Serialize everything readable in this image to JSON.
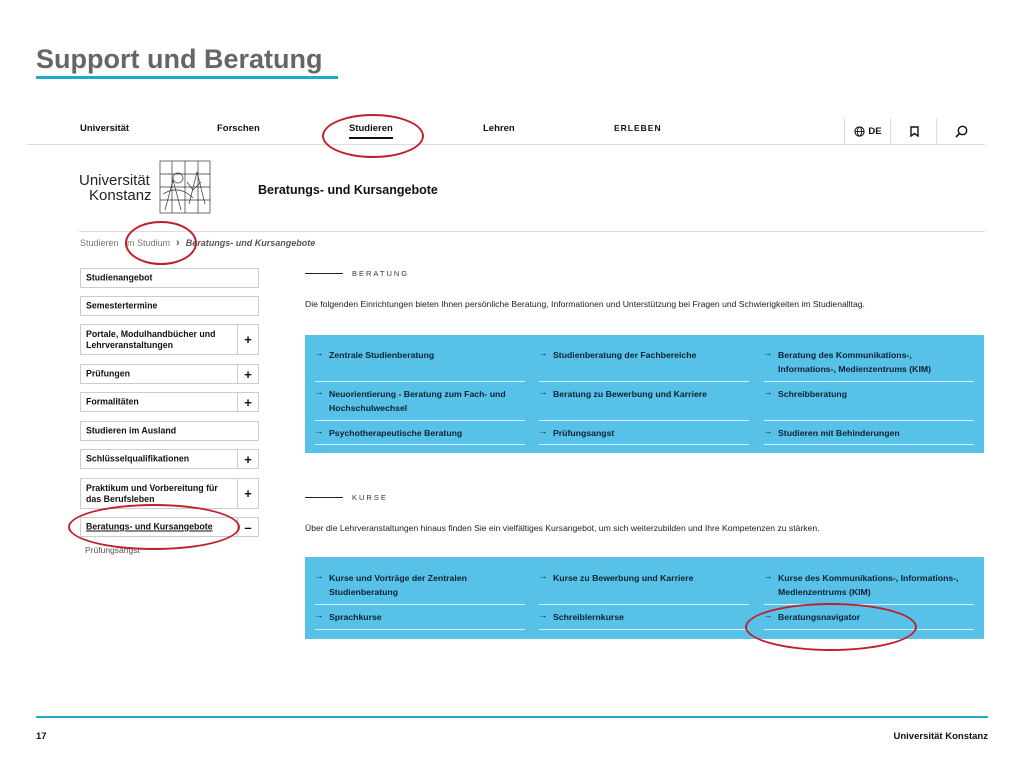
{
  "slide": {
    "title": "Support und Beratung",
    "page_number": "17",
    "footer_text": "Universität Konstanz"
  },
  "website": {
    "nav": {
      "items": [
        "Universität",
        "Forschen",
        "Studieren",
        "Lehren",
        "ERLEBEN"
      ],
      "active": "Studieren",
      "language": "DE",
      "bookmark_icon": "bookmark-icon",
      "search_icon": "search-icon"
    },
    "logo": {
      "line1": "Universität",
      "line2": "Konstanz"
    },
    "page_heading": "Beratungs- und Kursangebote",
    "breadcrumb": [
      "Studieren",
      "Im Studium",
      "Beratungs- und Kursangebote"
    ],
    "sidebar": {
      "items": [
        {
          "label": "Studienangebot",
          "toggle": ""
        },
        {
          "label": "Semestertermine",
          "toggle": ""
        },
        {
          "label": "Portale, Modulhandbücher und Lehrveranstaltungen",
          "toggle": "+"
        },
        {
          "label": "Prüfungen",
          "toggle": "+"
        },
        {
          "label": "Formalitäten",
          "toggle": "+"
        },
        {
          "label": "Studieren im Ausland",
          "toggle": ""
        },
        {
          "label": "Schlüsselqualifikationen",
          "toggle": "+"
        },
        {
          "label": "Praktikum und Vorbereitung für das Berufsleben",
          "toggle": "+"
        },
        {
          "label": "Beratungs- und Kursangebote",
          "toggle": "–"
        }
      ],
      "sub_item": "Prüfungsangst"
    },
    "beratung": {
      "label": "BERATUNG",
      "intro": "Die folgenden Einrichtungen bieten Ihnen persönliche Beratung, Informationen und Unterstützung bei Fragen und Schwierigkeiten im Studienalltag.",
      "links": [
        "Zentrale Studienberatung",
        "Studienberatung der Fachbereiche",
        "Beratung des Kommunikations-, Informations-, Medienzentrums (KIM)",
        "Neuorientierung - Beratung zum Fach- und Hochschulwechsel",
        "Beratung zu Bewerbung und Karriere",
        "Schreibberatung",
        "Psychotherapeutische Beratung",
        "Prüfungsangst",
        "Studieren mit Behinderungen"
      ]
    },
    "kurse": {
      "label": "KURSE",
      "intro": "Über die Lehrveranstaltungen hinaus finden Sie ein vielfältiges Kursangebot, um sich weiterzubilden und Ihre Kompetenzen zu stärken.",
      "links": [
        "Kurse und Vorträge der Zentralen Studienberatung",
        "Kurse zu Bewerbung und Karriere",
        "Kurse des Kommunikations-, Informations-, Medienzentrums (KIM)",
        "Sprachkurse",
        "Schreiblernkurse",
        "Beratungsnavigator"
      ]
    },
    "arrow_glyph": "→",
    "accent_color": "#57c1e8",
    "highlight_color": "#c0202a"
  }
}
